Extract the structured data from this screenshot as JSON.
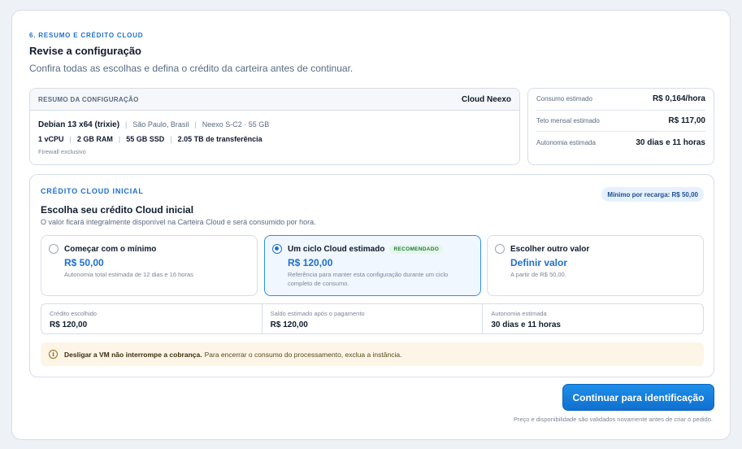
{
  "header": {
    "step": "6. RESUMO E CRÉDITO CLOUD",
    "title": "Revise a configuração",
    "subtitle": "Confira todas as escolhas e defina o crédito da carteira antes de continuar."
  },
  "summary": {
    "label": "RESUMO DA CONFIGURAÇÃO",
    "provider": "Cloud Neexo",
    "os": "Debian 13 x64 (trixie)",
    "location": "São Paulo, Brasil",
    "plan": "Neexo S-C2 · 55 GB",
    "vcpu": "1 vCPU",
    "ram": "2 GB RAM",
    "ssd": "55 GB SSD",
    "transfer": "2.05 TB de transferência",
    "firewall": "Firewall exclusivo"
  },
  "metrics": [
    {
      "label": "Consumo estimado",
      "value": "R$ 0,164/hora"
    },
    {
      "label": "Teto mensal estimado",
      "value": "R$ 117,00"
    },
    {
      "label": "Autonomia estimada",
      "value": "30 dias e 11 horas"
    }
  ],
  "credit": {
    "eyebrow": "CRÉDITO CLOUD INICIAL",
    "min_pill": "Mínimo por recarga: R$ 50,00",
    "title": "Escolha seu crédito Cloud inicial",
    "subtitle": "O valor ficará integralmente disponível na Carteira Cloud e será consumido por hora.",
    "options": [
      {
        "name": "Começar com o mínimo",
        "value": "R$ 50,00",
        "desc": "Autonomia total estimada de 12 dias e 16 horas",
        "badge": ""
      },
      {
        "name": "Um ciclo Cloud estimado",
        "value": "R$ 120,00",
        "desc": "Referência para manter esta configuração durante um ciclo completo de consumo.",
        "badge": "RECOMENDADO"
      },
      {
        "name": "Escolher outro valor",
        "value": "Definir valor",
        "desc": "A partir de R$ 50,00.",
        "badge": ""
      }
    ],
    "stats": [
      {
        "label": "Crédito escolhido",
        "value": "R$ 120,00"
      },
      {
        "label": "Saldo estimado após o pagamento",
        "value": "R$ 120,00"
      },
      {
        "label": "Autonomia estimada",
        "value": "30 dias e 11 horas"
      }
    ],
    "notice_bold": "Desligar a VM não interrompe a cobrança.",
    "notice_text": "Para encerrar o consumo do processamento, exclua a instância."
  },
  "footer": {
    "cta": "Continuar para identificação",
    "note": "Preço e disponibilidade são validados novamente antes de criar o pedido."
  },
  "colors": {
    "accent": "#1d6fd1",
    "button": "#1170cf",
    "notice_bg": "#fdf6e7",
    "badge_green": "#1e7d3c"
  },
  "icons": {
    "notice": "info-icon"
  }
}
